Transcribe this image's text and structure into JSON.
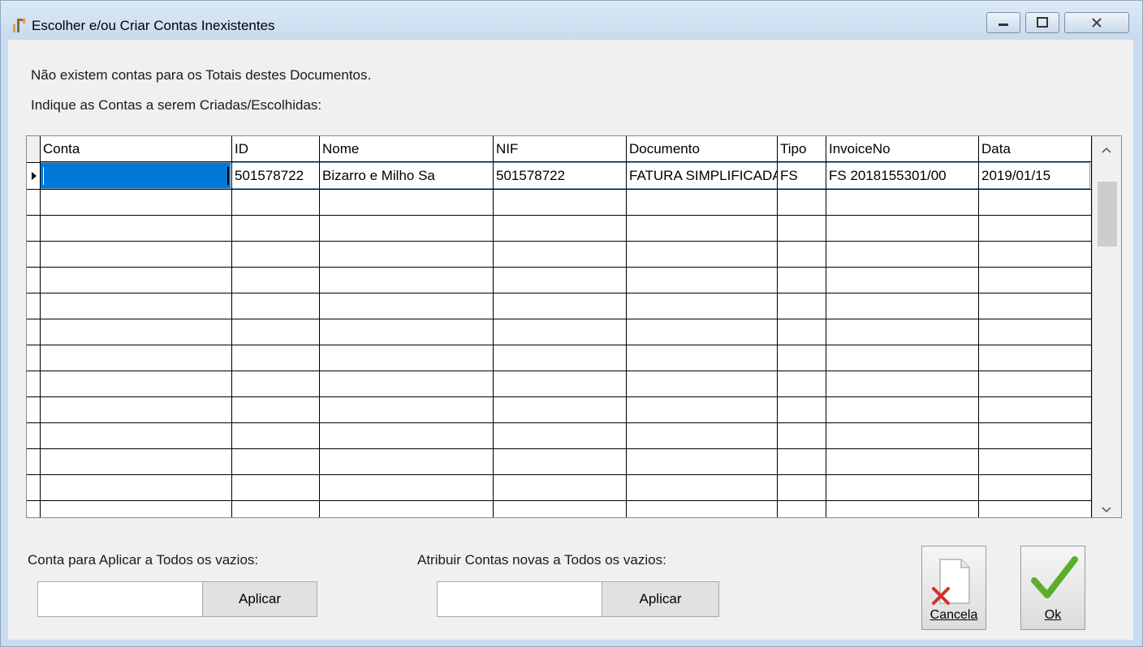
{
  "window": {
    "title": "Escolher e/ou Criar Contas Inexistentes"
  },
  "messages": {
    "line1": "Não existem contas para os Totais destes Documentos.",
    "line2": "Indique as Contas a serem Criadas/Escolhidas:"
  },
  "grid": {
    "columns": [
      "Conta",
      "ID",
      "Nome",
      "NIF",
      "Documento",
      "Tipo",
      "InvoiceNo",
      "Data"
    ],
    "rows": [
      {
        "conta": "",
        "id": "501578722",
        "nome": "Bizarro e Milho Sa",
        "nif": "501578722",
        "documento": "FATURA SIMPLIFICADA",
        "tipo": "FS",
        "invoice_no": "FS 2018155301/00",
        "data": "2019/01/15"
      }
    ]
  },
  "apply_all": {
    "label": "Conta para Aplicar a Todos os vazios:",
    "value": "",
    "button": "Aplicar"
  },
  "assign_new": {
    "label": "Atribuir Contas novas a Todos os vazios:",
    "value": "",
    "button": "Aplicar"
  },
  "buttons": {
    "cancel": "Cancela",
    "ok": "Ok"
  },
  "colors": {
    "selection": "#0078d7",
    "titlebar": "#c7dbee",
    "check_green": "#5cae2a",
    "cross_red": "#d0312d"
  }
}
